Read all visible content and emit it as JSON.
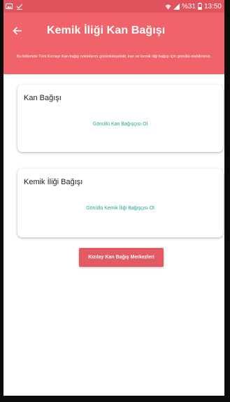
{
  "status_bar": {
    "battery_percent": "%31",
    "time": "13:50",
    "left_icons": [
      "image-icon",
      "checkmark-download-icon"
    ],
    "right_icons": [
      "wifi-icon",
      "signal-icon",
      "battery-icon"
    ]
  },
  "app_bar": {
    "back_icon": "arrow-left-icon",
    "title": "Kemik İliği Kan Bağışı"
  },
  "banner": {
    "text": "Bu bölümde Türk Kızılayı Kan bağış noktalarını görüntüleyebilir, kan ve kemik iliği bağışı için gönüllü olabilirsiniz."
  },
  "cards": [
    {
      "title": "Kan Bağışı",
      "link": "Gönüllü Kan Bağışçısı Ol"
    },
    {
      "title": "Kemik İliği Bağışı",
      "link": "Gönüllü Kemik İliği Bağışçısı Ol"
    }
  ],
  "action_button": {
    "label": "Kızılay Kan Bağış Merkezleri"
  },
  "colors": {
    "accent": "#f0636b",
    "status_bar": "#e2525c",
    "link": "#1aa890",
    "button": "#e35a63"
  }
}
